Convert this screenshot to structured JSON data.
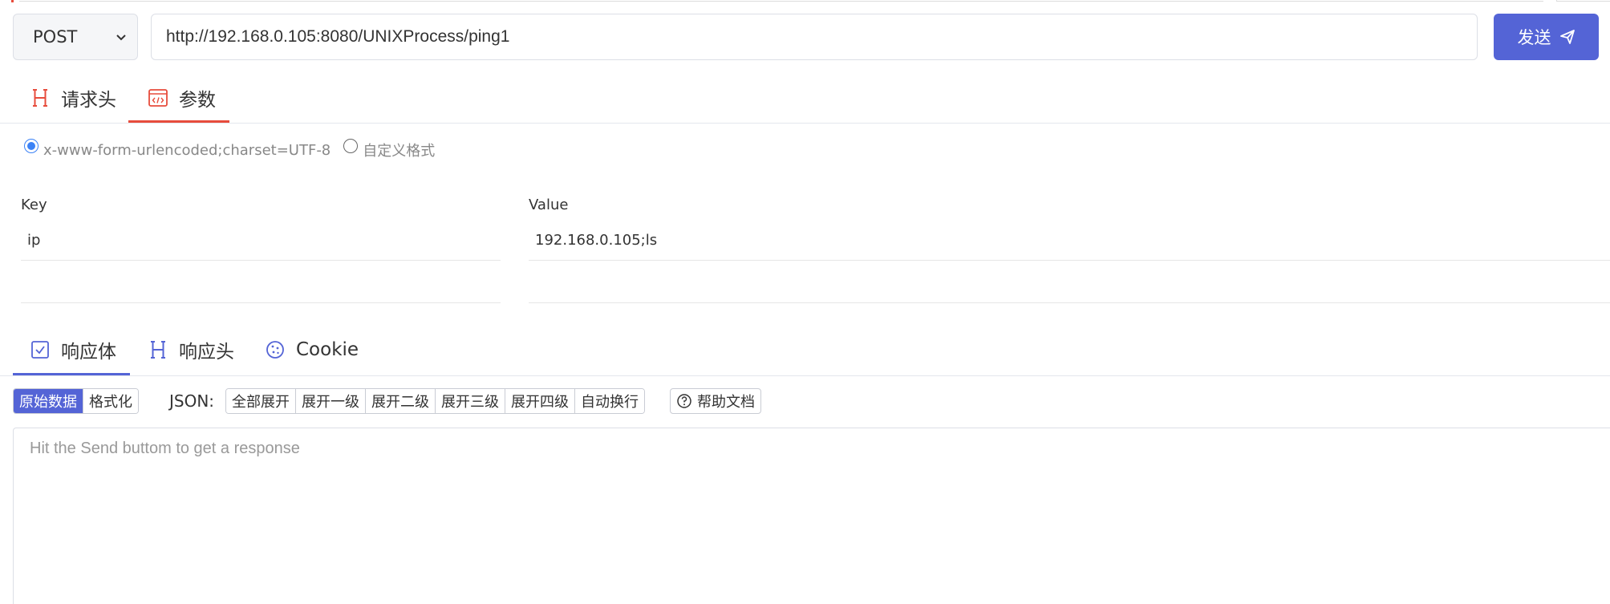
{
  "request": {
    "method": "POST",
    "url": "http://192.168.0.105:8080/UNIXProcess/ping1",
    "send_label": "发送"
  },
  "request_tabs": [
    {
      "label": "请求头",
      "icon": "h-header-icon"
    },
    {
      "label": "参数",
      "icon": "code-window-icon",
      "active": true
    }
  ],
  "encoding": {
    "option1": "x-www-form-urlencoded;charset=UTF-8",
    "option2": "自定义格式",
    "selected": "x-www-form-urlencoded;charset=UTF-8"
  },
  "params": {
    "headers": {
      "key": "Key",
      "value": "Value"
    },
    "rows": [
      {
        "key": "ip",
        "value": "192.168.0.105;ls"
      },
      {
        "key": "",
        "value": ""
      }
    ]
  },
  "response_tabs": [
    {
      "label": "响应体",
      "icon": "checkbox-icon",
      "active": true
    },
    {
      "label": "响应头",
      "icon": "h-header-icon"
    },
    {
      "label": "Cookie",
      "icon": "cookie-icon"
    }
  ],
  "toolbar": {
    "raw_label": "原始数据",
    "format_label": "格式化",
    "json_label": "JSON:",
    "expand_all": "全部展开",
    "expand_1": "展开一级",
    "expand_2": "展开二级",
    "expand_3": "展开三级",
    "expand_4": "展开四级",
    "word_wrap": "自动换行",
    "help": "帮助文档"
  },
  "response": {
    "placeholder": "Hit the Send buttom to get a response"
  },
  "colors": {
    "accent": "#5464d6",
    "tab_active_red": "#e74c3c"
  }
}
